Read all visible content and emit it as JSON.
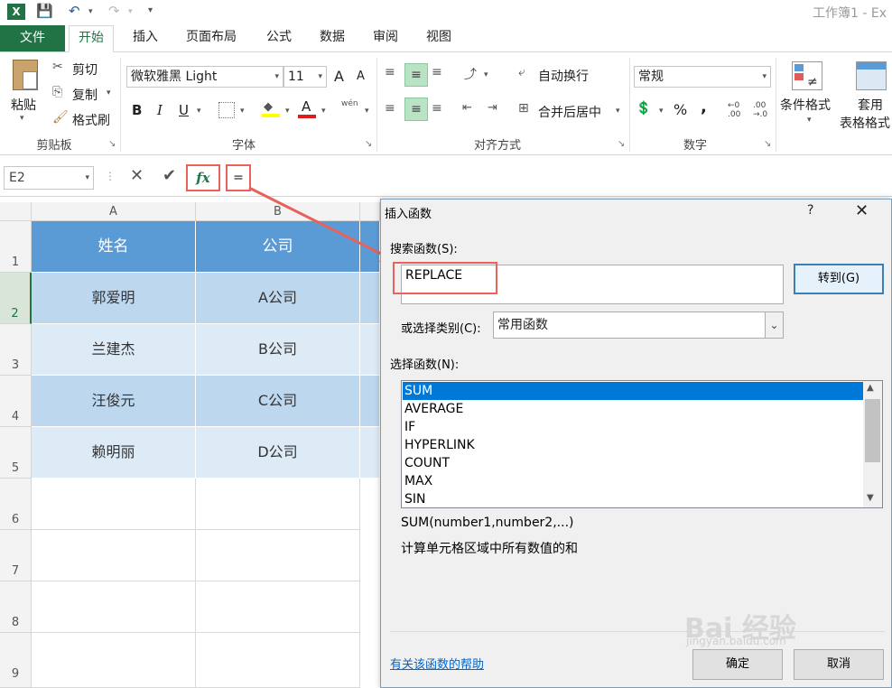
{
  "window": {
    "title": "工作簿1 - Ex"
  },
  "tabs": {
    "file": "文件",
    "items": [
      "开始",
      "插入",
      "页面布局",
      "公式",
      "数据",
      "审阅",
      "视图"
    ]
  },
  "clipboard": {
    "paste": "粘贴",
    "cut": "剪切",
    "copy": "复制",
    "format_painter": "格式刷",
    "label": "剪贴板"
  },
  "font": {
    "name": "微软雅黑 Light",
    "size": "11",
    "grow": "A",
    "shrink": "A",
    "bold": "B",
    "italic": "I",
    "underline": "U",
    "color_a": "A",
    "phonetic": "wén",
    "label": "字体"
  },
  "alignment": {
    "wrap": "自动换行",
    "merge": "合并后居中",
    "label": "对齐方式"
  },
  "number": {
    "format": "常规",
    "percent": "%",
    "comma": ",",
    "label": "数字"
  },
  "styles": {
    "conditional": "条件格式",
    "table_format_1": "套用",
    "table_format_2": "表格格式"
  },
  "formula_bar": {
    "name_box": "E2",
    "fx": "fx",
    "content": "="
  },
  "sheet": {
    "columns": [
      "A",
      "B"
    ],
    "rows": [
      "1",
      "2",
      "3",
      "4",
      "5",
      "6",
      "7",
      "8",
      "9"
    ],
    "header": [
      "姓名",
      "公司"
    ],
    "data": [
      [
        "郭爱明",
        "A公司"
      ],
      [
        "兰建杰",
        "B公司"
      ],
      [
        "汪俊元",
        "C公司"
      ],
      [
        "赖明丽",
        "D公司"
      ]
    ]
  },
  "dialog": {
    "title": "插入函数",
    "help_char": "?",
    "search_label": "搜索函数(S):",
    "search_value": "REPLACE",
    "go_button": "转到(G)",
    "category_label": "或选择类别(C):",
    "category_value": "常用函数",
    "select_label": "选择函数(N):",
    "functions": [
      "SUM",
      "AVERAGE",
      "IF",
      "HYPERLINK",
      "COUNT",
      "MAX",
      "SIN"
    ],
    "selected_function": "SUM",
    "syntax": "SUM(number1,number2,...)",
    "description": "计算单元格区域中所有数值的和",
    "help_link": "有关该函数的帮助",
    "ok": "确定",
    "cancel": "取消"
  },
  "watermark": {
    "text": "Bai 经验",
    "sub": "jingyan.baidu.com"
  },
  "colors": {
    "excel_green": "#217346",
    "header_blue": "#5b9bd5",
    "band1": "#bdd7ee",
    "band2": "#ddebf7",
    "highlight": "#e8615a",
    "selection": "#0078d7"
  }
}
